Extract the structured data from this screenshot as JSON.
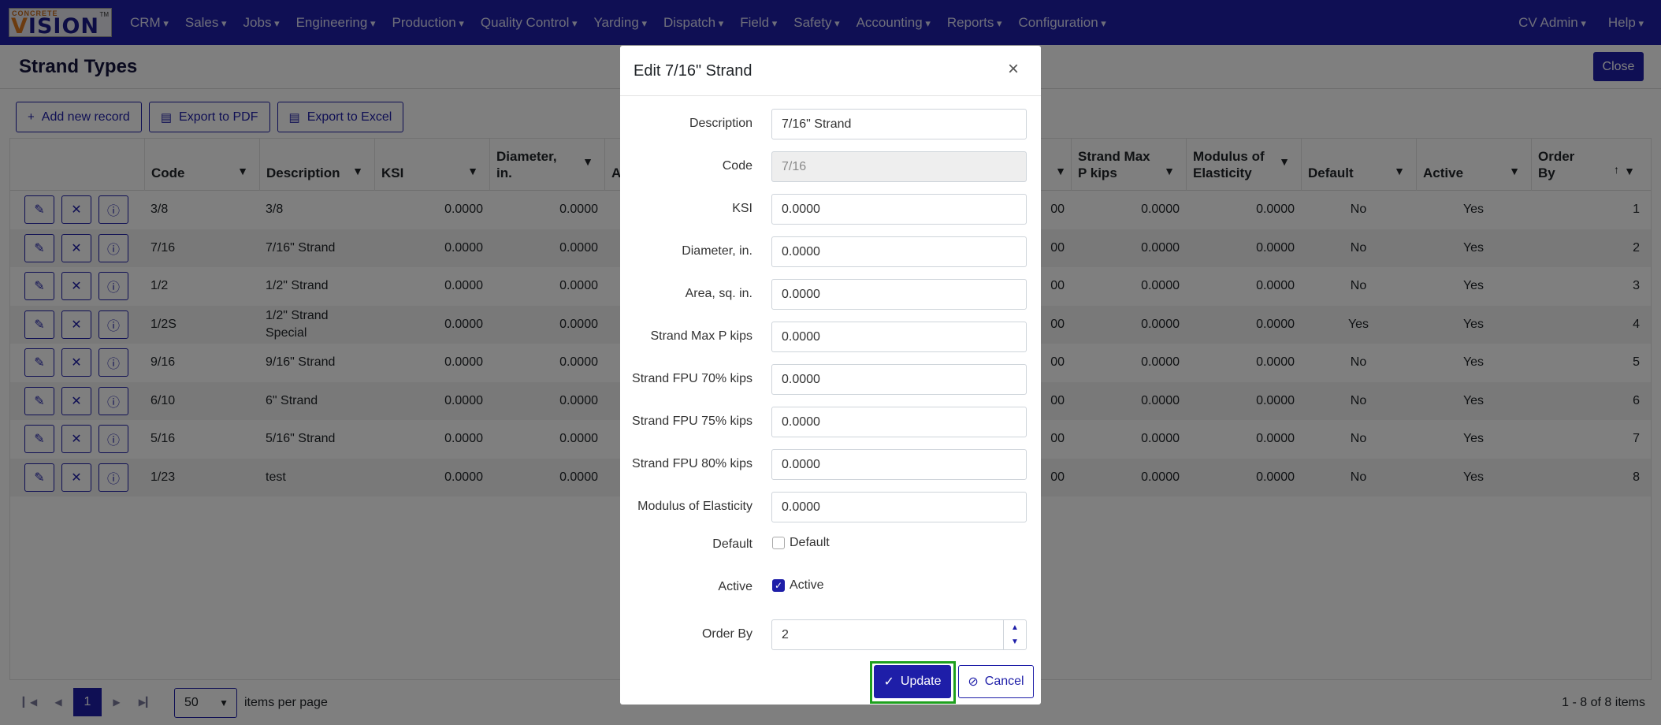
{
  "app": {
    "logo_small": "CONCRETE",
    "logo_v": "V",
    "logo_rest": "ISION",
    "logo_tm": "TM"
  },
  "nav": {
    "items": [
      "CRM",
      "Sales",
      "Jobs",
      "Engineering",
      "Production",
      "Quality Control",
      "Yarding",
      "Dispatch",
      "Field",
      "Safety",
      "Accounting",
      "Reports",
      "Configuration"
    ],
    "user": "CV Admin",
    "help": "Help"
  },
  "page": {
    "title": "Strand Types",
    "close_label": "Close"
  },
  "toolbar": {
    "add_label": "Add new record",
    "pdf_label": "Export to PDF",
    "excel_label": "Export to Excel"
  },
  "grid": {
    "headers": {
      "code": "Code",
      "description": "Description",
      "ksi": "KSI",
      "diameter_1": "Diameter,",
      "diameter_2": "in.",
      "area_partial": "Ar",
      "strand_max_1": "Strand Max",
      "strand_max_2": "P kips",
      "modulus_1": "Modulus of",
      "modulus_2": "Elasticity",
      "default": "Default",
      "active": "Active",
      "order_1": "Order",
      "order_2": "By"
    },
    "rows": [
      {
        "code": "3/8",
        "description": "3/8",
        "ksi": "0.0000",
        "diameter": "0.0000",
        "partial": "00",
        "strand_max": "0.0000",
        "modulus": "0.0000",
        "default": "No",
        "active": "Yes",
        "order": "1"
      },
      {
        "code": "7/16",
        "description": "7/16\" Strand",
        "ksi": "0.0000",
        "diameter": "0.0000",
        "partial": "00",
        "strand_max": "0.0000",
        "modulus": "0.0000",
        "default": "No",
        "active": "Yes",
        "order": "2"
      },
      {
        "code": "1/2",
        "description": "1/2\" Strand",
        "ksi": "0.0000",
        "diameter": "0.0000",
        "partial": "00",
        "strand_max": "0.0000",
        "modulus": "0.0000",
        "default": "No",
        "active": "Yes",
        "order": "3"
      },
      {
        "code": "1/2S",
        "description": "1/2\" Strand Special",
        "ksi": "0.0000",
        "diameter": "0.0000",
        "partial": "00",
        "strand_max": "0.0000",
        "modulus": "0.0000",
        "default": "Yes",
        "active": "Yes",
        "order": "4"
      },
      {
        "code": "9/16",
        "description": "9/16\" Strand",
        "ksi": "0.0000",
        "diameter": "0.0000",
        "partial": "00",
        "strand_max": "0.0000",
        "modulus": "0.0000",
        "default": "No",
        "active": "Yes",
        "order": "5"
      },
      {
        "code": "6/10",
        "description": " 6\" Strand",
        "ksi": "0.0000",
        "diameter": "0.0000",
        "partial": "00",
        "strand_max": "0.0000",
        "modulus": "0.0000",
        "default": "No",
        "active": "Yes",
        "order": "6"
      },
      {
        "code": "5/16",
        "description": "5/16\" Strand",
        "ksi": "0.0000",
        "diameter": "0.0000",
        "partial": "00",
        "strand_max": "0.0000",
        "modulus": "0.0000",
        "default": "No",
        "active": "Yes",
        "order": "7"
      },
      {
        "code": "1/23",
        "description": "test",
        "ksi": "0.0000",
        "diameter": "0.0000",
        "partial": "00",
        "strand_max": "0.0000",
        "modulus": "0.0000",
        "default": "No",
        "active": "Yes",
        "order": "8"
      }
    ]
  },
  "pager": {
    "current_page": "1",
    "page_size": "50",
    "items_label": "items per page",
    "info": "1 - 8 of 8 items"
  },
  "modal": {
    "title": "Edit 7/16\" Strand",
    "close_glyph": "×",
    "fields": [
      {
        "label": "Description",
        "value": "7/16\" Strand"
      },
      {
        "label": "Code",
        "value": "7/16",
        "disabled": true
      },
      {
        "label": "KSI",
        "value": "0.0000"
      },
      {
        "label": "Diameter, in.",
        "value": "0.0000"
      },
      {
        "label": "Area, sq. in.",
        "value": "0.0000"
      },
      {
        "label": "Strand Max P kips",
        "value": "0.0000"
      },
      {
        "label": "Strand FPU 70% kips",
        "value": "0.0000"
      },
      {
        "label": "Strand FPU 75% kips",
        "value": "0.0000"
      },
      {
        "label": "Strand FPU 80% kips",
        "value": "0.0000"
      },
      {
        "label": "Modulus of Elasticity",
        "value": "0.0000"
      }
    ],
    "default": {
      "label": "Default",
      "check_label": "Default",
      "checked": false
    },
    "active": {
      "label": "Active",
      "check_label": "Active",
      "checked": true
    },
    "order_by": {
      "label": "Order By",
      "value": "2"
    },
    "update_label": "Update",
    "cancel_label": "Cancel"
  },
  "colors": {
    "brand": "#1e1ea8",
    "highlight": "#1ea01e"
  }
}
